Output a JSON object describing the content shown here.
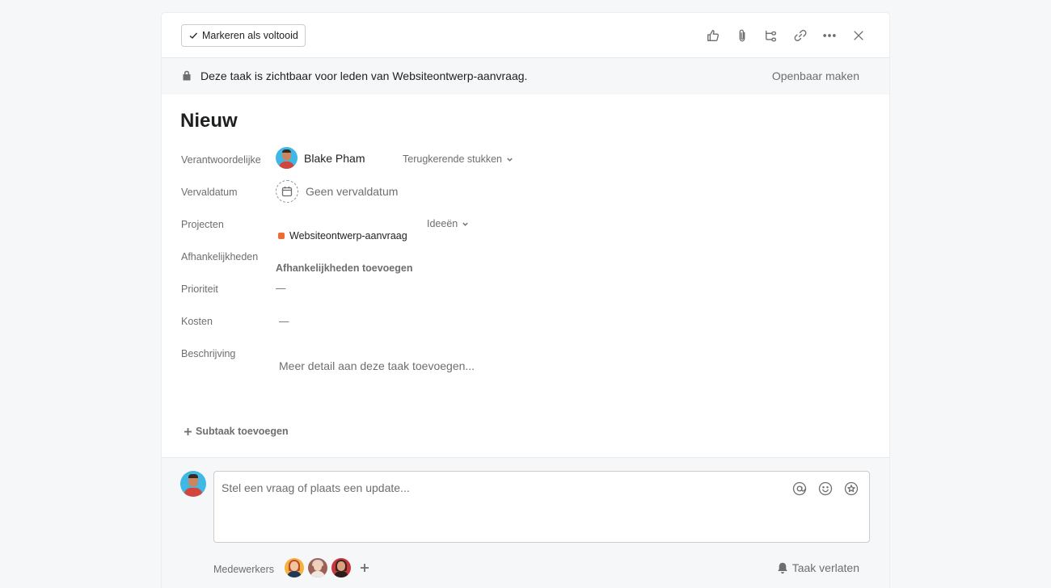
{
  "toolbar": {
    "complete_label": "Markeren als voltooid",
    "icons": [
      "thumbs-up-icon",
      "paperclip-icon",
      "subtask-icon",
      "link-icon",
      "more-icon",
      "close-icon"
    ]
  },
  "privacy": {
    "text": "Deze taak is zichtbaar voor leden van Websiteontwerp-aanvraag.",
    "action": "Openbaar maken"
  },
  "task": {
    "title": "Nieuw"
  },
  "fields": {
    "assignee": {
      "label": "Verantwoordelijke",
      "name": "Blake Pham",
      "recurring": "Terugkerende stukken"
    },
    "due_date": {
      "label": "Vervaldatum",
      "value": "Geen vervaldatum"
    },
    "projects": {
      "label": "Projecten",
      "project": "Websiteontwerp-aanvraag",
      "section": "Ideeën",
      "project_color": "#f06a34"
    },
    "dependencies": {
      "label": "Afhankelijkheden",
      "action": "Afhankelijkheden toevoegen"
    },
    "priority": {
      "label": "Prioriteit",
      "value": "—"
    },
    "cost": {
      "label": "Kosten",
      "value": "—"
    },
    "description": {
      "label": "Beschrijving",
      "placeholder": "Meer detail aan deze taak toevoegen..."
    }
  },
  "subtask": {
    "label": "Subtaak toevoegen"
  },
  "comment": {
    "placeholder": "Stel een vraag of plaats een update..."
  },
  "collaborators": {
    "label": "Medewerkers",
    "leave_label": "Taak verlaten"
  }
}
